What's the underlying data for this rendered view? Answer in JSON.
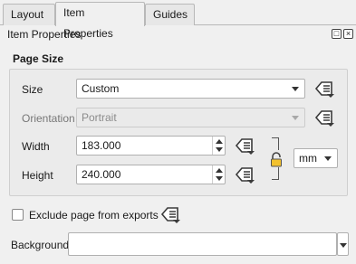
{
  "tabs": [
    {
      "label": "Layout",
      "active": false
    },
    {
      "label": "Item Properties",
      "active": true
    },
    {
      "label": "Guides",
      "active": false
    }
  ],
  "panel": {
    "title": "Item Properties",
    "float_icon": "float-icon",
    "close_icon": "close-icon"
  },
  "page_size": {
    "group_title": "Page Size",
    "size_label": "Size",
    "size_value": "Custom",
    "orientation_label": "Orientation",
    "orientation_value": "Portrait",
    "width_label": "Width",
    "width_value": "183.000",
    "height_label": "Height",
    "height_value": "240.000",
    "units_value": "mm",
    "lock_icon": "lock-icon"
  },
  "exclude": {
    "label": "Exclude page from exports",
    "checked": false
  },
  "background": {
    "label": "Background",
    "value": ""
  },
  "colors": {
    "accent_yellow": "#f2c12e",
    "icon_dark": "#3a3a3a"
  }
}
